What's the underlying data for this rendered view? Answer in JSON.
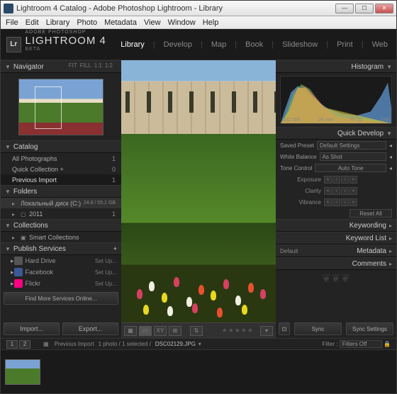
{
  "window": {
    "title": "Lightroom 4 Catalog - Adobe Photoshop Lightroom - Library"
  },
  "menu": [
    "File",
    "Edit",
    "Library",
    "Photo",
    "Metadata",
    "View",
    "Window",
    "Help"
  ],
  "brand": {
    "sup": "ADOBE PHOTOSHOP",
    "name": "LIGHTROOM 4",
    "badge": "Lr",
    "beta": "BETA"
  },
  "modules": [
    "Library",
    "Develop",
    "Map",
    "Book",
    "Slideshow",
    "Print",
    "Web"
  ],
  "active_module": "Library",
  "left": {
    "navigator": {
      "label": "Navigator",
      "opts": [
        "FIT",
        "FILL",
        "1:1",
        "1:2"
      ]
    },
    "catalog": {
      "label": "Catalog",
      "items": [
        {
          "label": "All Photographs",
          "count": "1"
        },
        {
          "label": "Quick Collection +",
          "count": "0"
        },
        {
          "label": "Previous Import",
          "count": "1",
          "sel": true
        }
      ]
    },
    "folders": {
      "label": "Folders",
      "drive": "Локальный диск (C:)",
      "drive_meta": "24.8 / 55.1 GB",
      "items": [
        {
          "label": "2011",
          "count": "1"
        }
      ]
    },
    "collections": {
      "label": "Collections",
      "items": [
        {
          "label": "Smart Collections"
        }
      ]
    },
    "publish": {
      "label": "Publish Services",
      "items": [
        {
          "label": "Hard Drive",
          "setup": "Set Up..."
        },
        {
          "label": "Facebook",
          "setup": "Set Up...",
          "cls": "fb"
        },
        {
          "label": "Flickr",
          "setup": "Set Up...",
          "cls": "fl"
        }
      ],
      "find": "Find More Services Online..."
    },
    "import": "Import...",
    "export": "Export..."
  },
  "right": {
    "histogram": {
      "label": "Histogram",
      "meta": [
        "ISO 100",
        "26 mm",
        "f / 13",
        "1/60"
      ]
    },
    "quickdev": {
      "label": "Quick Develop",
      "preset": {
        "label": "Saved Preset",
        "value": "Default Settings"
      },
      "wb": {
        "label": "White Balance",
        "value": "As Shot"
      },
      "tone": {
        "label": "Tone Control",
        "auto": "Auto Tone"
      },
      "sliders": [
        "Exposure",
        "Clarity",
        "Vibrance"
      ],
      "reset": "Reset All"
    },
    "keywording": "Keywording",
    "keywordlist": "Keyword List",
    "metadata": {
      "label": "Metadata",
      "preset": "Default"
    },
    "comments": "Comments",
    "sync": "Sync",
    "syncset": "Sync Settings"
  },
  "filmstrip": {
    "pages": [
      "1",
      "2"
    ],
    "source": "Previous Import",
    "count": "1 photo / 1 selected /",
    "file": "DSC02129.JPG",
    "filter_label": "Filter :",
    "filter": "Filters Off"
  }
}
